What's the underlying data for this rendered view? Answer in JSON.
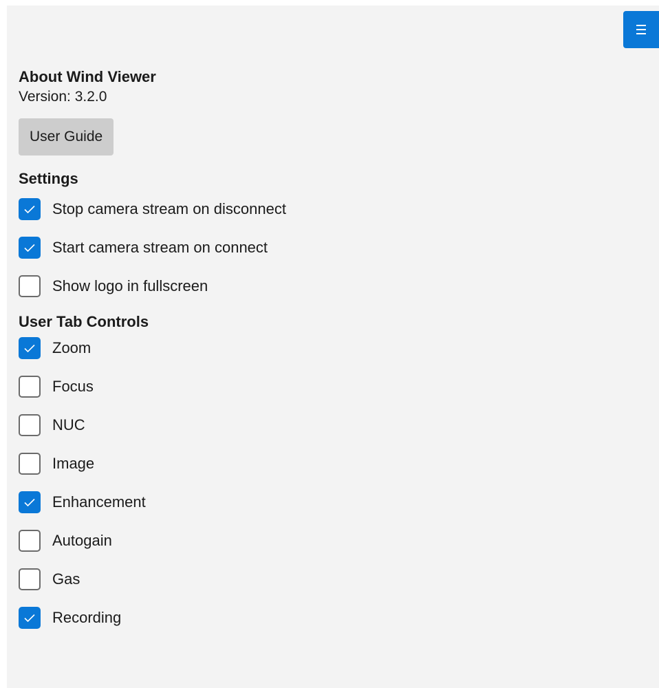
{
  "menu": {
    "icon": "hamburger-menu-icon",
    "color": "#0a78d7"
  },
  "about": {
    "title": "About Wind Viewer",
    "version_text": "Version: 3.2.0",
    "user_guide_label": "User Guide"
  },
  "settings": {
    "heading": "Settings",
    "items": [
      {
        "label": "Stop camera stream on disconnect",
        "checked": true
      },
      {
        "label": "Start camera stream on connect",
        "checked": true
      },
      {
        "label": "Show logo in fullscreen",
        "checked": false
      }
    ]
  },
  "user_tab_controls": {
    "heading": "User Tab Controls",
    "items": [
      {
        "label": "Zoom",
        "checked": true
      },
      {
        "label": "Focus",
        "checked": false
      },
      {
        "label": "NUC",
        "checked": false
      },
      {
        "label": "Image",
        "checked": false
      },
      {
        "label": "Enhancement",
        "checked": true
      },
      {
        "label": "Autogain",
        "checked": false
      },
      {
        "label": "Gas",
        "checked": false
      },
      {
        "label": "Recording",
        "checked": true
      }
    ]
  },
  "colors": {
    "accent": "#0a78d7",
    "panel_background": "#f3f3f3",
    "button_background": "#cdcdcd"
  }
}
